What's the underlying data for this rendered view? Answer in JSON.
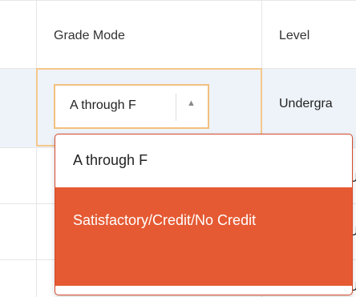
{
  "header": {
    "grade_mode_label": "Grade Mode",
    "level_label": "Level"
  },
  "row": {
    "grade_mode_value": "A through F",
    "level_value": "Undergra"
  },
  "dropdown": {
    "options": [
      "A through F",
      "Satisfactory/Credit/No Credit"
    ],
    "selected_option": "Satisfactory/Credit/No Credit",
    "selected_color": "#e55a33"
  },
  "select_arrow_icon": "triangle-up-icon",
  "colors": {
    "focus_border": "#f3c07f",
    "row_highlight": "#eef3f9"
  }
}
